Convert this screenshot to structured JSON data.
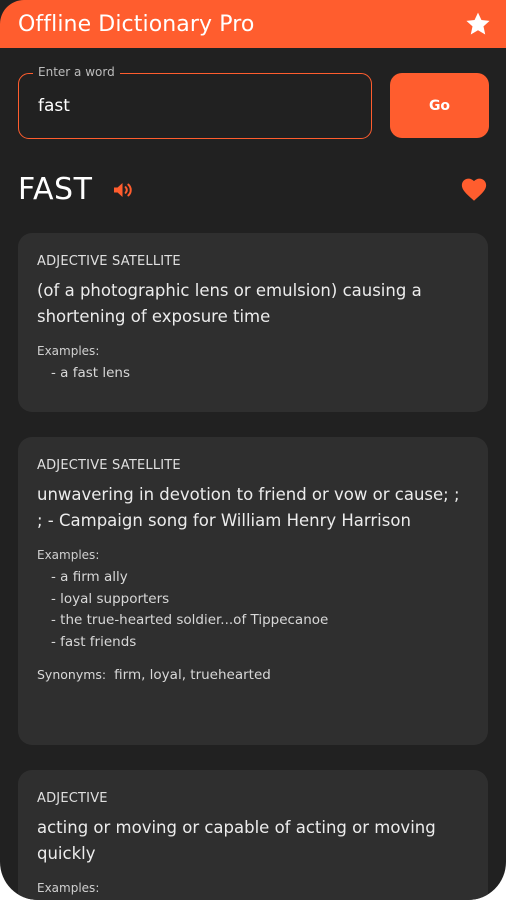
{
  "app": {
    "title": "Offline Dictionary Pro",
    "accent": "#ff5d2e",
    "background": "#212121",
    "card_background": "#2f2f2f",
    "favorites_icon": "star-icon"
  },
  "search": {
    "label": "Enter a word",
    "value": "fast",
    "go_label": "Go"
  },
  "word": {
    "title": "FAST",
    "pronounce_icon": "speaker-icon",
    "favorite_icon": "heart-icon"
  },
  "entries": [
    {
      "pos": "ADJECTIVE SATELLITE",
      "definition": "(of a photographic lens or emulsion) causing a shortening of exposure time",
      "examples_label": "Examples:",
      "examples": [
        "- a fast lens"
      ]
    },
    {
      "pos": "ADJECTIVE SATELLITE",
      "definition": "unwavering in devotion to friend or vow or cause; ; ; - Campaign song for William Henry Harrison",
      "examples_label": "Examples:",
      "examples": [
        "- a firm ally",
        "- loyal supporters",
        "- the true-hearted soldier...of Tippecanoe",
        "- fast friends"
      ],
      "synonyms_label": "Synonyms:",
      "synonyms": "firm, loyal, truehearted"
    },
    {
      "pos": "ADJECTIVE",
      "definition": "acting or moving or capable of acting or moving quickly",
      "examples_label": "Examples:"
    }
  ]
}
